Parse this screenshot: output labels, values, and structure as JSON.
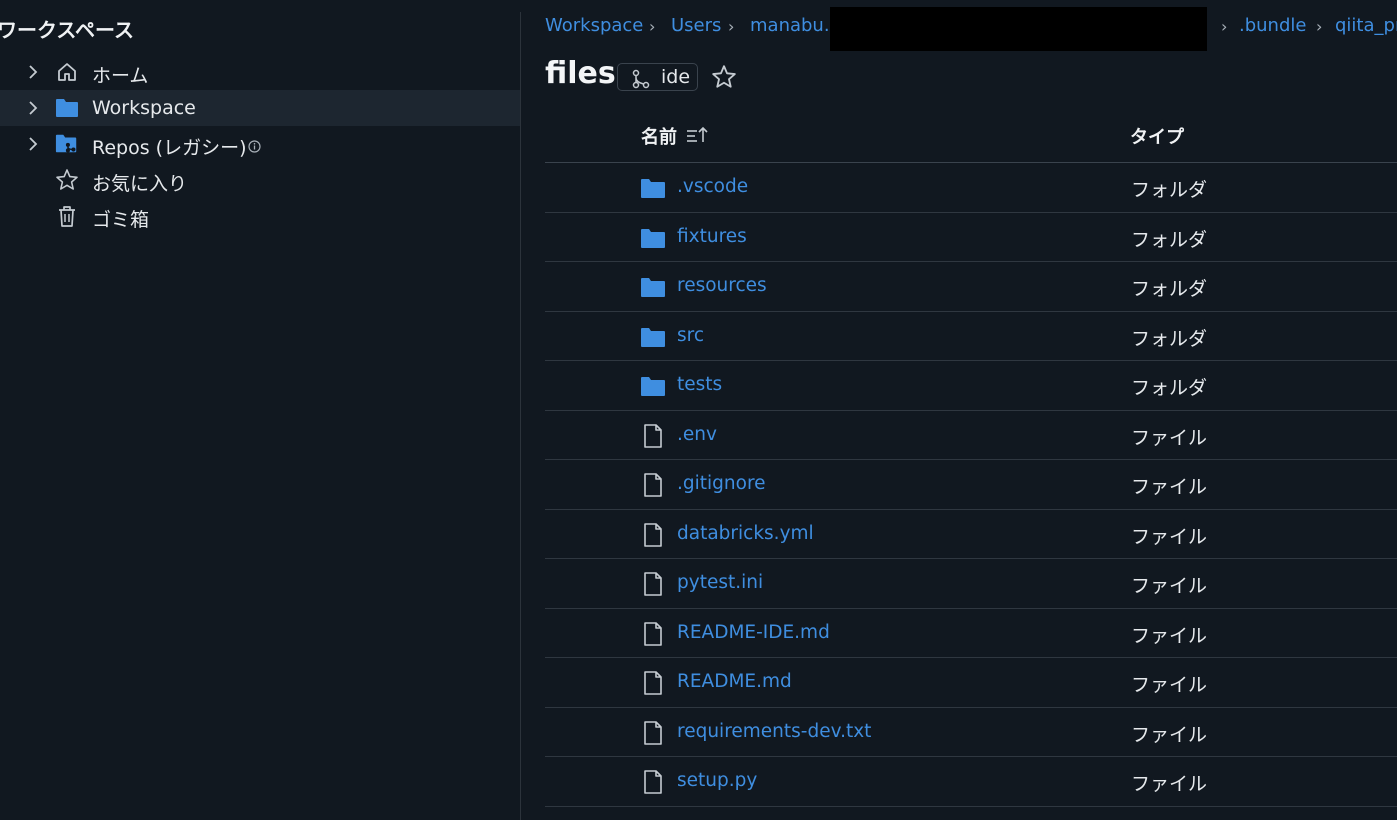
{
  "sidebar": {
    "title": "ワークスペース",
    "items": [
      {
        "label": "ホーム",
        "icon": "home-icon",
        "expandable": true
      },
      {
        "label": "Workspace",
        "icon": "folder-icon",
        "expandable": true,
        "selected": true
      },
      {
        "label": "Repos (レガシー)",
        "icon": "repos-folder-icon",
        "expandable": true,
        "info": true
      },
      {
        "label": "お気に入り",
        "icon": "star-icon",
        "expandable": false
      },
      {
        "label": "ゴミ箱",
        "icon": "trash-icon",
        "expandable": false
      }
    ]
  },
  "breadcrumb": {
    "items": [
      "Workspace",
      "Users",
      "manabu.s",
      ".bundle",
      "qiita_pr"
    ]
  },
  "header": {
    "title": "files",
    "branch": "ide"
  },
  "table": {
    "columns": {
      "name": "名前",
      "type": "タイプ"
    },
    "rows": [
      {
        "name": ".vscode",
        "type": "フォルダ",
        "kind": "folder"
      },
      {
        "name": "fixtures",
        "type": "フォルダ",
        "kind": "folder"
      },
      {
        "name": "resources",
        "type": "フォルダ",
        "kind": "folder"
      },
      {
        "name": "src",
        "type": "フォルダ",
        "kind": "folder"
      },
      {
        "name": "tests",
        "type": "フォルダ",
        "kind": "folder"
      },
      {
        "name": ".env",
        "type": "ファイル",
        "kind": "file"
      },
      {
        "name": ".gitignore",
        "type": "ファイル",
        "kind": "file"
      },
      {
        "name": "databricks.yml",
        "type": "ファイル",
        "kind": "file"
      },
      {
        "name": "pytest.ini",
        "type": "ファイル",
        "kind": "file"
      },
      {
        "name": "README-IDE.md",
        "type": "ファイル",
        "kind": "file"
      },
      {
        "name": "README.md",
        "type": "ファイル",
        "kind": "file"
      },
      {
        "name": "requirements-dev.txt",
        "type": "ファイル",
        "kind": "file"
      },
      {
        "name": "setup.py",
        "type": "ファイル",
        "kind": "file"
      }
    ]
  },
  "colors": {
    "background": "#111820",
    "link": "#3f8ee0",
    "folder": "#3f8ee0",
    "text": "#e6e9ec",
    "selected_row": "#1d2630"
  }
}
